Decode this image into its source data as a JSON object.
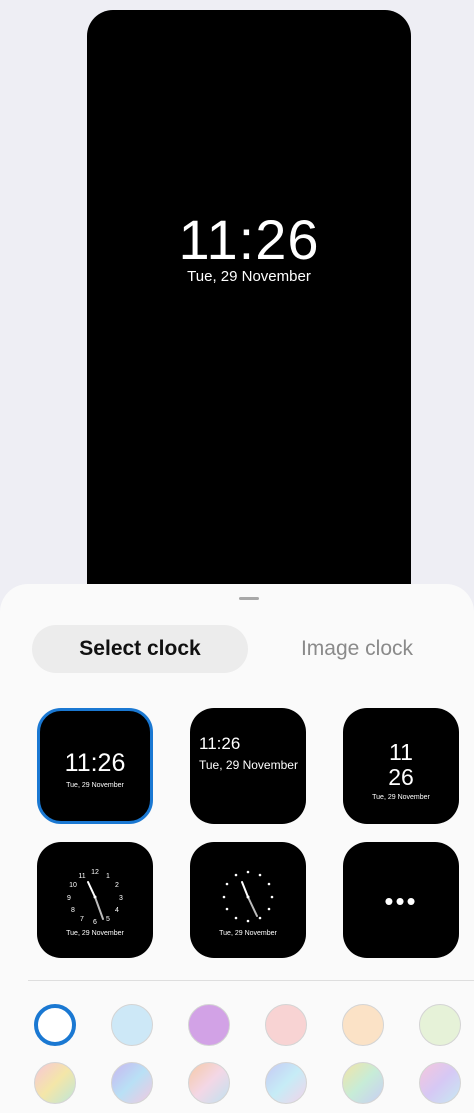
{
  "preview": {
    "time": "11:26",
    "date": "Tue, 29 November"
  },
  "tabs": {
    "select_clock": "Select clock",
    "image_clock": "Image clock"
  },
  "clock_styles": [
    {
      "time": "11:26",
      "date": "Tue, 29 November",
      "selected": true
    },
    {
      "time": "11:26",
      "date": "Tue, 29 November"
    },
    {
      "hours": "11",
      "minutes": "26",
      "date": "Tue, 29 November"
    },
    {
      "date": "Tue, 29 November",
      "dial_numbers": [
        "12",
        "1",
        "2",
        "3",
        "4",
        "5",
        "6",
        "7",
        "8",
        "9",
        "10",
        "11"
      ]
    },
    {
      "date": "Tue, 29 November"
    },
    {
      "icon": "more-icon",
      "label": "•••"
    }
  ],
  "colors": {
    "accent": "#1a78d2",
    "swatches_row1": [
      "#ffffff",
      "#cde8f7",
      "#d2a2e6",
      "#f8d3d3",
      "#fbe2c6",
      "#e6f2d8"
    ],
    "swatches_row2": [
      "gradient-1",
      "gradient-2",
      "gradient-3",
      "gradient-4",
      "gradient-5",
      "gradient-6"
    ]
  }
}
